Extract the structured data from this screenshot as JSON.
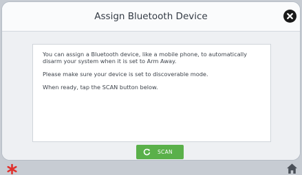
{
  "dialog": {
    "title": "Assign Bluetooth Device",
    "close_icon": "close-icon",
    "paragraphs": [
      "You can assign a Bluetooth device, like a mobile phone, to automatically disarm your system when it is set to Arm Away.",
      "Please make sure your device is set to discoverable mode.",
      "When ready, tap the SCAN button below."
    ],
    "scan_button": {
      "label": "SCAN",
      "icon": "refresh-icon"
    }
  },
  "footer": {
    "left_icon": "asterisk-icon",
    "right_icon": "home-icon"
  },
  "colors": {
    "accent_green": "#5ab04a",
    "asterisk_red": "#e0312d",
    "background": "#c7ccd3"
  }
}
